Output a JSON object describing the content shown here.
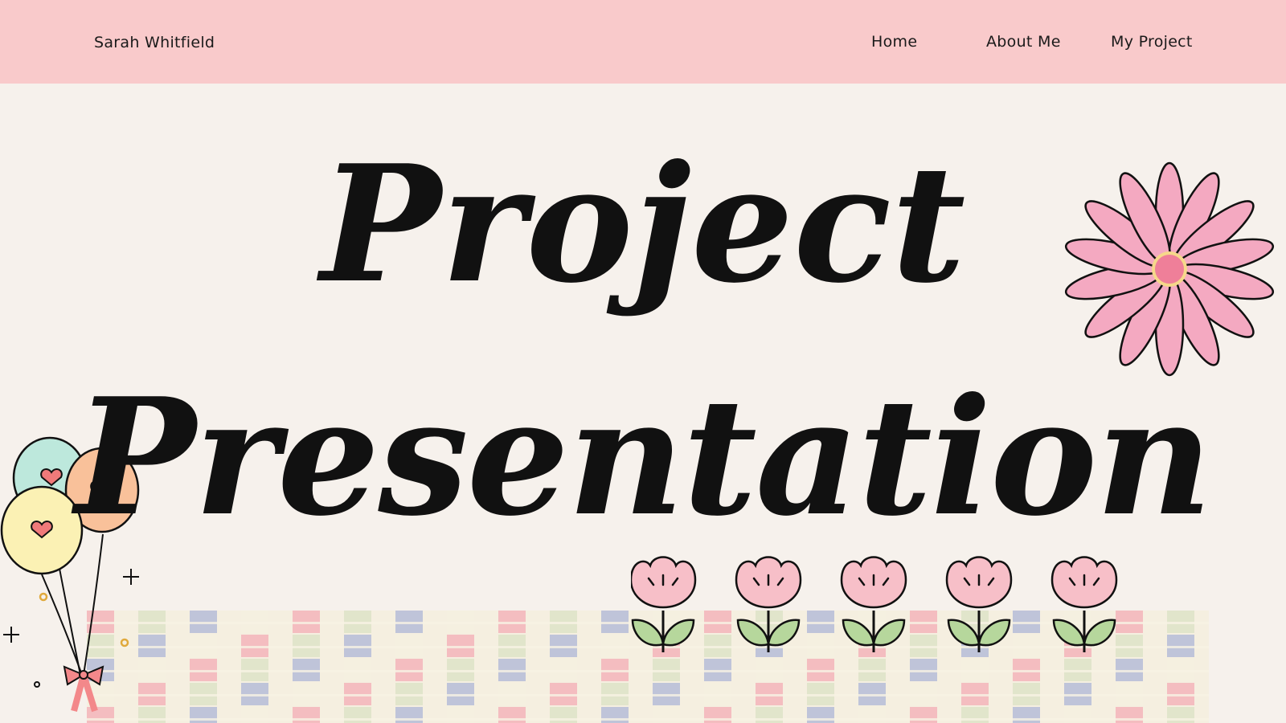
{
  "header": {
    "brand": "Sarah Whitfield",
    "nav": [
      "Home",
      "About Me",
      "My Project"
    ]
  },
  "hero": {
    "line1": "Project",
    "line2": "Presentation"
  },
  "colors": {
    "header_bg": "#f9cacb",
    "page_bg": "#f6f1ec",
    "pink": "#f4a9b8",
    "mint": "#bde8dc",
    "peach": "#f9c19a",
    "butter": "#fbf1b4",
    "heart": "#f07a7a",
    "leaf": "#b6d79c"
  },
  "icons": [
    "daisy-flower-icon",
    "balloons-icon",
    "tulip-icon",
    "sparkle-icon",
    "bow-icon"
  ]
}
